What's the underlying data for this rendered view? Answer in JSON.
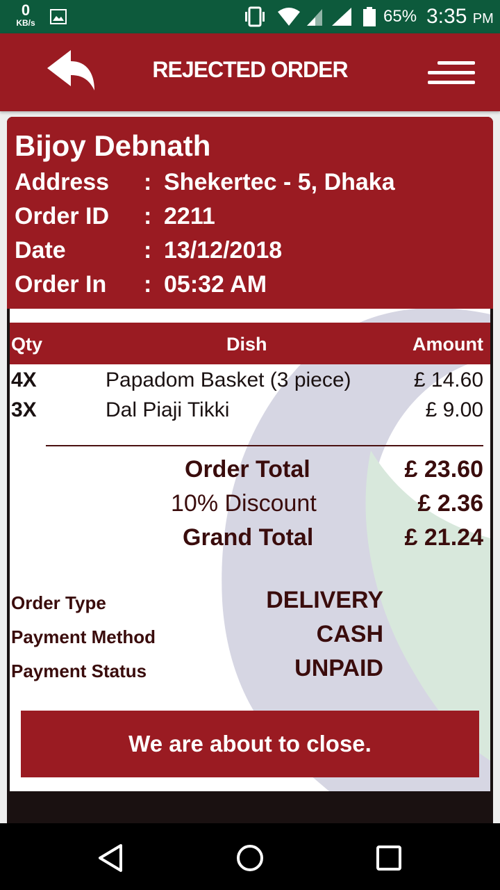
{
  "status_bar": {
    "net_speed_value": "0",
    "net_speed_unit": "KB/s",
    "battery_percent": "65%",
    "time": "3:35",
    "time_suffix": "PM"
  },
  "app_bar": {
    "title": "REJECTED ORDER",
    "back_icon": "reply-arrow-icon",
    "menu_icon": "hamburger-menu-icon"
  },
  "order": {
    "customer_name": "Bijoy Debnath",
    "separator": ":",
    "fields": [
      {
        "label": "Address",
        "value": "Shekertec - 5,  Dhaka"
      },
      {
        "label": "Order ID",
        "value": "2211"
      },
      {
        "label": "Date",
        "value": "13/12/2018"
      },
      {
        "label": "Order In",
        "value": "05:32 AM"
      }
    ]
  },
  "items_table": {
    "headers": {
      "qty": "Qty",
      "dish": "Dish",
      "amount": "Amount"
    },
    "rows": [
      {
        "qty": "4X",
        "dish": "Papadom Basket (3 piece)",
        "amount": "£ 14.60"
      },
      {
        "qty": "3X",
        "dish": "Dal Piaji Tikki",
        "amount": "£ 9.00"
      }
    ]
  },
  "totals": {
    "order_total_label": "Order Total",
    "order_total": "£ 23.60",
    "discount_label": "10% Discount",
    "discount": "£ 2.36",
    "grand_total_label": "Grand Total",
    "grand_total": "£ 21.24"
  },
  "order_meta": [
    {
      "label": "Order Type",
      "value": "DELIVERY"
    },
    {
      "label": "Payment Method",
      "value": "CASH"
    },
    {
      "label": "Payment Status",
      "value": "UNPAID"
    }
  ],
  "banner": {
    "message": "We are about to close."
  },
  "colors": {
    "brand": "#9a1b22",
    "status_bar": "#0d5a3c",
    "text_dark": "#3a0c0c"
  }
}
